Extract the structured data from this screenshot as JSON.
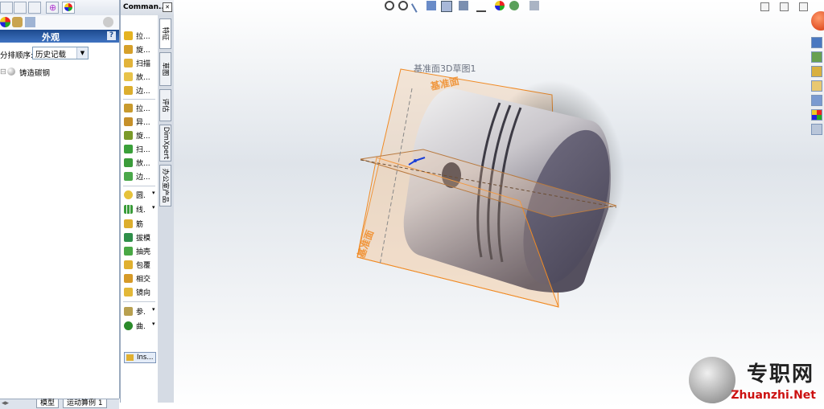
{
  "feature_manager": {
    "header_title": "外观",
    "help_label": "?",
    "order_label": "分排顺序:",
    "order_select_value": "历史记载",
    "tree_item_label": "铸造碳钢",
    "bottom_tabs": [
      "模型",
      "运动算例 1"
    ]
  },
  "command_manager": {
    "title": "Comman...",
    "items": [
      "拉...",
      "旋...",
      "扫描",
      "放...",
      "边...",
      "拉...",
      "异...",
      "旋...",
      "扫...",
      "放...",
      "边...",
      "圆.",
      "线.",
      "筋",
      "拔模",
      "抽壳",
      "包覆",
      "相交",
      "镜向",
      "参.",
      "曲."
    ],
    "insert_label": "Ins...",
    "side_tabs": [
      "特征",
      "草图",
      "评估",
      "DimXpert",
      "办公室产品"
    ]
  },
  "viewport": {
    "sketch_label": "基准面3D草图1",
    "plane_label_top": "基准面",
    "plane_label_side": "基准面"
  },
  "watermark": {
    "brand_cn": "专职网",
    "brand_url": "Zhuanzhi.Net"
  },
  "colors": {
    "plane_orange": "#f08a24",
    "header_blue": "#2a5aa6",
    "brand_red": "#cc1010"
  }
}
